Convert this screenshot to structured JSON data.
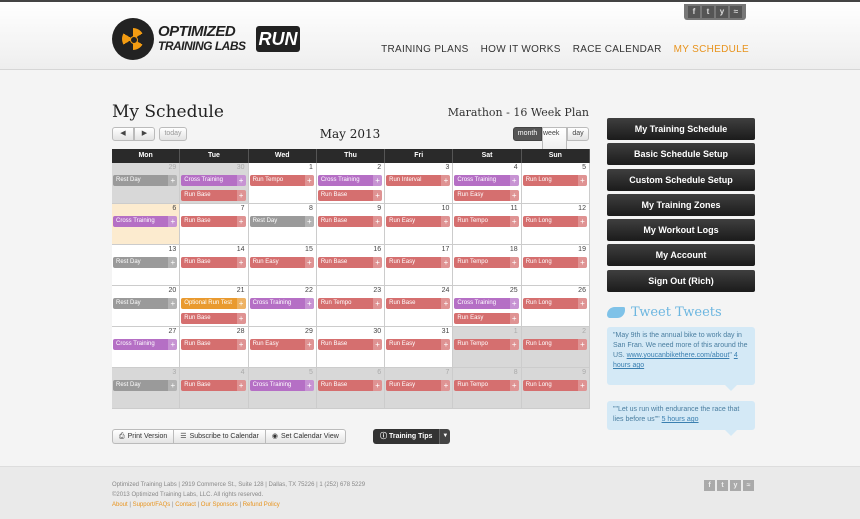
{
  "header": {
    "logo_line1": "OPTIMIZED",
    "logo_line2": "TRAINING LABS",
    "logo_run": "RUN",
    "social": [
      "f",
      "t",
      "y",
      "rss"
    ],
    "nav": [
      {
        "label": "TRAINING PLANS",
        "active": false
      },
      {
        "label": "HOW IT WORKS",
        "active": false
      },
      {
        "label": "RACE CALENDAR",
        "active": false
      },
      {
        "label": "MY SCHEDULE",
        "active": true
      }
    ],
    "accent_color": "#e8931c"
  },
  "page": {
    "title": "My Schedule",
    "plan": "Marathon - 16 Week Plan"
  },
  "calendar": {
    "prev": "◀",
    "next": "▶",
    "today": "today",
    "month_label": "May 2013",
    "views": {
      "month": "month",
      "week": "week",
      "day": "day"
    },
    "selected_view": "month",
    "days": [
      "Mon",
      "Tue",
      "Wed",
      "Thu",
      "Fri",
      "Sat",
      "Sun"
    ],
    "weeks": [
      [
        {
          "n": "29",
          "other": true,
          "ev": [
            {
              "t": "Rest Day",
              "c": "rest"
            }
          ]
        },
        {
          "n": "30",
          "other": true,
          "ev": [
            {
              "t": "Cross Training",
              "c": "cross"
            },
            {
              "t": "Run Base",
              "c": "run"
            }
          ]
        },
        {
          "n": "1",
          "ev": [
            {
              "t": "Run Tempo",
              "c": "run"
            }
          ]
        },
        {
          "n": "2",
          "ev": [
            {
              "t": "Cross Training",
              "c": "cross"
            },
            {
              "t": "Run Base",
              "c": "run"
            }
          ]
        },
        {
          "n": "3",
          "ev": [
            {
              "t": "Run Interval",
              "c": "run"
            }
          ]
        },
        {
          "n": "4",
          "ev": [
            {
              "t": "Cross Training",
              "c": "cross"
            },
            {
              "t": "Run Easy",
              "c": "run"
            }
          ]
        },
        {
          "n": "5",
          "ev": [
            {
              "t": "Run Long",
              "c": "run"
            }
          ]
        }
      ],
      [
        {
          "n": "6",
          "today": true,
          "ev": [
            {
              "t": "Cross Training",
              "c": "cross"
            }
          ]
        },
        {
          "n": "7",
          "ev": [
            {
              "t": "Run Base",
              "c": "run"
            }
          ]
        },
        {
          "n": "8",
          "ev": [
            {
              "t": "Rest Day",
              "c": "rest"
            }
          ]
        },
        {
          "n": "9",
          "ev": [
            {
              "t": "Run Base",
              "c": "run"
            }
          ]
        },
        {
          "n": "10",
          "ev": [
            {
              "t": "Run Easy",
              "c": "run"
            }
          ]
        },
        {
          "n": "11",
          "ev": [
            {
              "t": "Run Tempo",
              "c": "run"
            }
          ]
        },
        {
          "n": "12",
          "ev": [
            {
              "t": "Run Long",
              "c": "run"
            }
          ]
        }
      ],
      [
        {
          "n": "13",
          "ev": [
            {
              "t": "Rest Day",
              "c": "rest"
            }
          ]
        },
        {
          "n": "14",
          "ev": [
            {
              "t": "Run Base",
              "c": "run"
            }
          ]
        },
        {
          "n": "15",
          "ev": [
            {
              "t": "Run Easy",
              "c": "run"
            }
          ]
        },
        {
          "n": "16",
          "ev": [
            {
              "t": "Run Base",
              "c": "run"
            }
          ]
        },
        {
          "n": "17",
          "ev": [
            {
              "t": "Run Easy",
              "c": "run"
            }
          ]
        },
        {
          "n": "18",
          "ev": [
            {
              "t": "Run Tempo",
              "c": "run"
            }
          ]
        },
        {
          "n": "19",
          "ev": [
            {
              "t": "Run Long",
              "c": "run"
            }
          ]
        }
      ],
      [
        {
          "n": "20",
          "ev": [
            {
              "t": "Rest Day",
              "c": "rest"
            }
          ]
        },
        {
          "n": "21",
          "ev": [
            {
              "t": "Optional Run Test",
              "c": "opt"
            },
            {
              "t": "Run Base",
              "c": "run"
            }
          ]
        },
        {
          "n": "22",
          "ev": [
            {
              "t": "Cross Training",
              "c": "cross"
            }
          ]
        },
        {
          "n": "23",
          "ev": [
            {
              "t": "Run Tempo",
              "c": "run"
            }
          ]
        },
        {
          "n": "24",
          "ev": [
            {
              "t": "Run Base",
              "c": "run"
            }
          ]
        },
        {
          "n": "25",
          "ev": [
            {
              "t": "Cross Training",
              "c": "cross"
            },
            {
              "t": "Run Easy",
              "c": "run"
            }
          ]
        },
        {
          "n": "26",
          "ev": [
            {
              "t": "Run Long",
              "c": "run"
            }
          ]
        }
      ],
      [
        {
          "n": "27",
          "ev": [
            {
              "t": "Cross Training",
              "c": "cross"
            }
          ]
        },
        {
          "n": "28",
          "ev": [
            {
              "t": "Run Base",
              "c": "run"
            }
          ]
        },
        {
          "n": "29",
          "ev": [
            {
              "t": "Run Easy",
              "c": "run"
            }
          ]
        },
        {
          "n": "30",
          "ev": [
            {
              "t": "Run Base",
              "c": "run"
            }
          ]
        },
        {
          "n": "31",
          "ev": [
            {
              "t": "Run Easy",
              "c": "run"
            }
          ]
        },
        {
          "n": "1",
          "other": true,
          "ev": [
            {
              "t": "Run Tempo",
              "c": "run"
            }
          ]
        },
        {
          "n": "2",
          "other": true,
          "ev": [
            {
              "t": "Run Long",
              "c": "run"
            }
          ]
        }
      ],
      [
        {
          "n": "3",
          "other": true,
          "ev": [
            {
              "t": "Rest Day",
              "c": "rest"
            }
          ]
        },
        {
          "n": "4",
          "other": true,
          "ev": [
            {
              "t": "Run Base",
              "c": "run"
            }
          ]
        },
        {
          "n": "5",
          "other": true,
          "ev": [
            {
              "t": "Cross Training",
              "c": "cross"
            }
          ]
        },
        {
          "n": "6",
          "other": true,
          "ev": [
            {
              "t": "Run Base",
              "c": "run"
            }
          ]
        },
        {
          "n": "7",
          "other": true,
          "ev": [
            {
              "t": "Run Easy",
              "c": "run"
            }
          ]
        },
        {
          "n": "8",
          "other": true,
          "ev": [
            {
              "t": "Run Tempo",
              "c": "run"
            }
          ]
        },
        {
          "n": "9",
          "other": true,
          "ev": [
            {
              "t": "Run Long",
              "c": "run"
            }
          ]
        }
      ]
    ]
  },
  "toolbar": {
    "print": "Print Version",
    "subscribe": "Subscribe to Calendar",
    "set_view": "Set Calendar View",
    "tips": "Training Tips"
  },
  "sidebar": {
    "items": [
      "My Training Schedule",
      "Basic Schedule Setup",
      "Custom Schedule Setup",
      "My Training Zones",
      "My Workout Logs",
      "My Account",
      "Sign Out (Rich)"
    ]
  },
  "tweets": {
    "title": "Tweet Tweets",
    "items": [
      {
        "text": "\"May 9th is the annual bike to work day in San Fran. We need more of this around the US.",
        "link": "www.youcanbikethere.com/about",
        "suffix": "\"",
        "time": "4 hours ago"
      },
      {
        "text": "\"\"Let us run with endurance the race that lies before us\"\"",
        "link": "",
        "suffix": "",
        "time": "5 hours ago"
      }
    ]
  },
  "footer": {
    "address": "Optimized Training Labs  |  2919 Commerce St., Suite 128  |  Dallas, TX 75226  |  1 (252) 678 5229",
    "copy_prefix": "©2013 ",
    "copy_link": "Optimized Training Labs, LLC",
    "copy_suffix": ". All rights reserved.",
    "links": [
      "About",
      "Support/FAQs",
      "Contact",
      "Our Sponsors",
      "Refund Policy"
    ]
  }
}
